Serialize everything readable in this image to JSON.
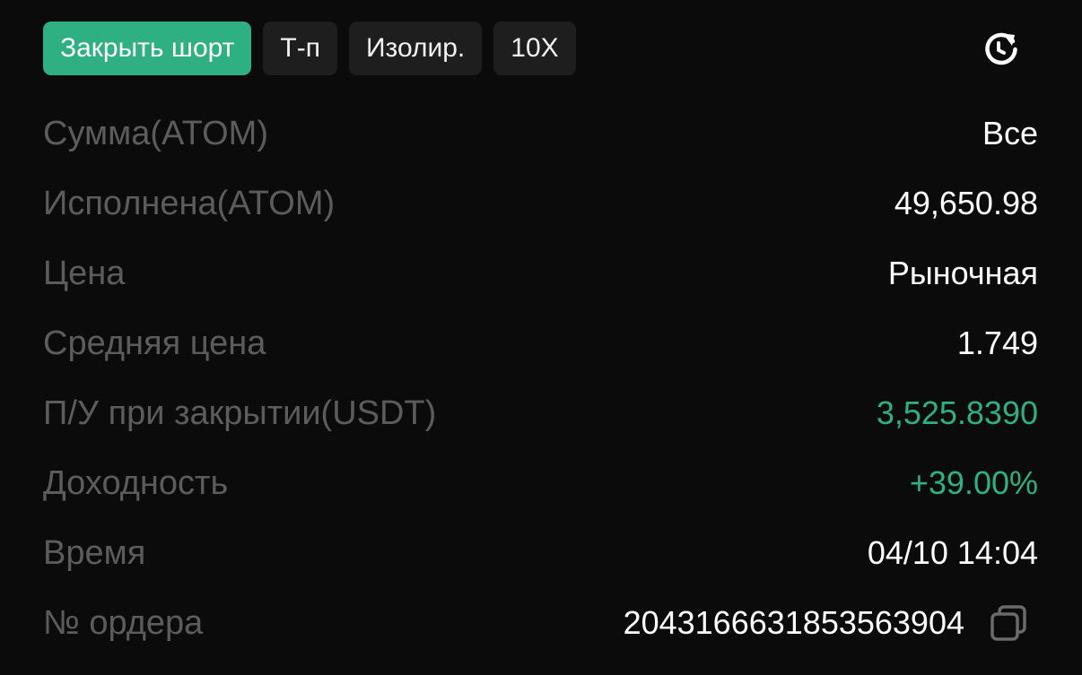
{
  "tags": [
    {
      "label": "Закрыть шорт",
      "style": "primary"
    },
    {
      "label": "Т-п"
    },
    {
      "label": "Изолир."
    },
    {
      "label": "10X"
    }
  ],
  "icons": {
    "refresh": "refresh-icon",
    "copy": "copy-icon"
  },
  "colors": {
    "background": "#0b0b0b",
    "accent_green": "#2fb082",
    "tag_background": "#1e1e1e",
    "label_gray": "#5c5c5c"
  },
  "rows": [
    {
      "label": "Сумма(ATOM)",
      "value": "Все"
    },
    {
      "label": "Исполнена(ATOM)",
      "value": "49,650.98"
    },
    {
      "label": "Цена",
      "value": "Рыночная"
    },
    {
      "label": "Средняя цена",
      "value": "1.749"
    },
    {
      "label": "П/У при закрытии(USDT)",
      "value": "3,525.8390"
    },
    {
      "label": "Доходность",
      "value": "+39.00%"
    },
    {
      "label": "Время",
      "value": "04/10 14:04"
    },
    {
      "label": "№ ордера",
      "value": "2043166631853563904"
    }
  ]
}
